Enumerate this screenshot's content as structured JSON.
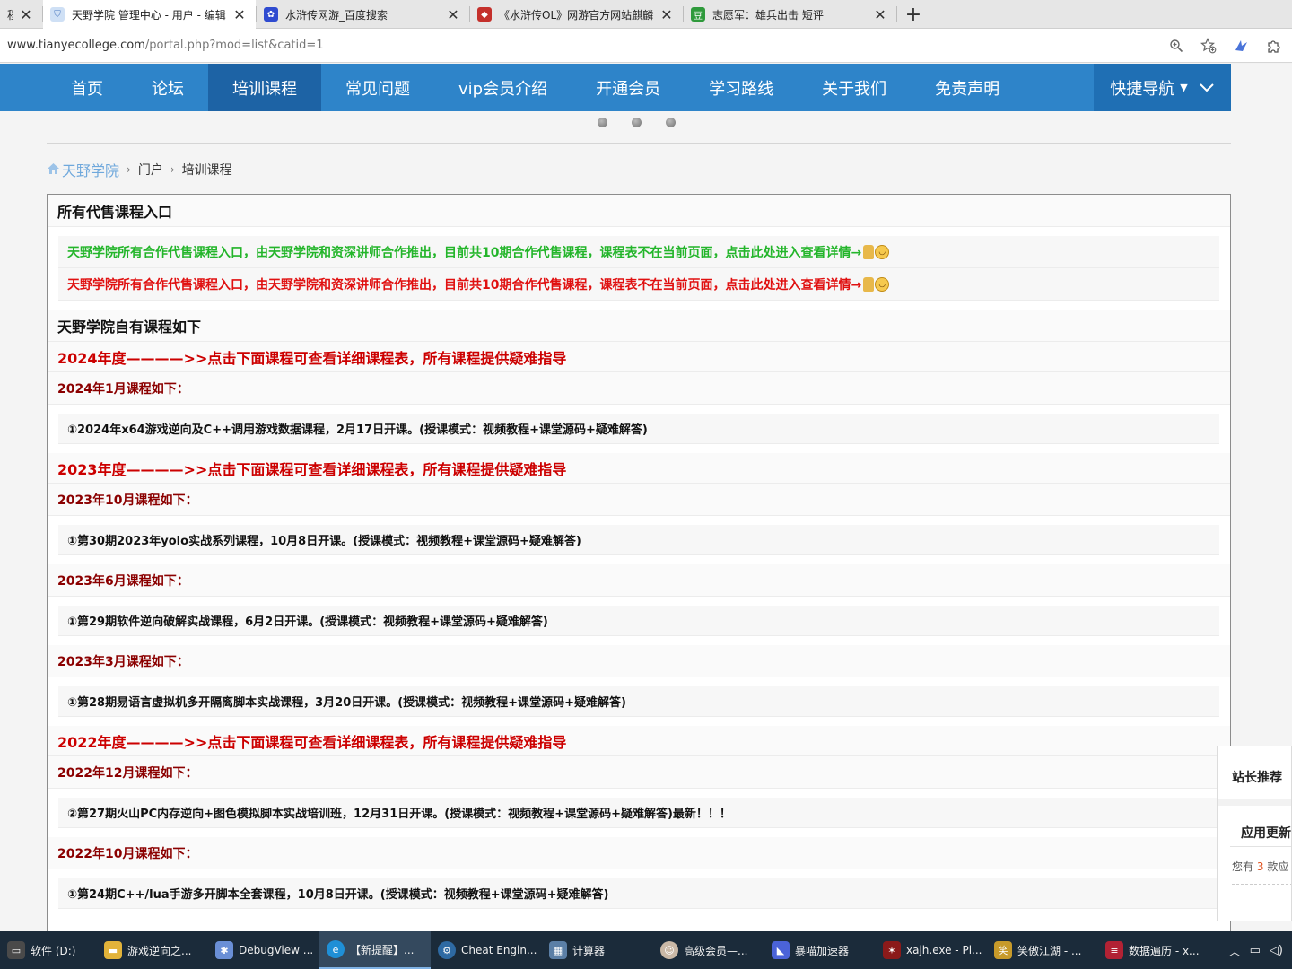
{
  "browser": {
    "tabs": [
      {
        "title": "程",
        "icon": "page-icon",
        "active": false
      },
      {
        "title": "天野学院 管理中心 - 用户 - 编辑",
        "icon": "shield-icon",
        "active": true
      },
      {
        "title": "水浒传网游_百度搜索",
        "icon": "baidu-paw-icon",
        "active": false
      },
      {
        "title": "《水浒传OL》网游官方网站麒麟",
        "icon": "game-site-icon",
        "active": false
      },
      {
        "title": "志愿军：雄兵出击 短评",
        "icon": "douban-icon",
        "active": false
      }
    ],
    "new_tab_glyph": "+",
    "close_glyph": "✕",
    "url_host": "www.tianyecollege.com",
    "url_path": "/portal.php?mod=list&catid=1"
  },
  "nav": {
    "items": [
      "首页",
      "论坛",
      "培训课程",
      "常见问题",
      "vip会员介绍",
      "开通会员",
      "学习路线",
      "关于我们",
      "免责声明"
    ],
    "active_index": 2,
    "quick_label": "快捷导航"
  },
  "breadcrumb": {
    "home": "天野学院",
    "items": [
      "门户",
      "培训课程"
    ]
  },
  "content": {
    "box_title": "所有代售课程入口",
    "notice_green": "天野学院所有合作代售课程入口，由天野学院和资深讲师合作推出，目前共10期合作代售课程，课程表不在当前页面，点击此处进入查看详情→",
    "notice_red": "天野学院所有合作代售课程入口，由天野学院和资深讲师合作推出，目前共10期合作代售课程，课程表不在当前页面，点击此处进入查看详情→",
    "own_title": "天野学院自有课程如下",
    "y2024": "2024年度————>>点击下面课程可查看详细课程表，所有课程提供疑难指导",
    "m2024_1": "2024年1月课程如下：",
    "c2024_1": "①2024年x64游戏逆向及C++调用游戏数据课程，2月17日开课。(授课模式：视频教程+课堂源码+疑难解答)",
    "y2023": "2023年度————>>点击下面课程可查看详细课程表，所有课程提供疑难指导",
    "m2023_10": "2023年10月课程如下：",
    "c2023_10": "①第30期2023年yolo实战系列课程，10月8日开课。(授课模式：视频教程+课堂源码+疑难解答)",
    "m2023_6": "2023年6月课程如下：",
    "c2023_6": "①第29期软件逆向破解实战课程，6月2日开课。(授课模式：视频教程+课堂源码+疑难解答)",
    "m2023_3": "2023年3月课程如下：",
    "c2023_3": "①第28期易语言虚拟机多开隔离脚本实战课程，3月20日开课。(授课模式：视频教程+课堂源码+疑难解答)",
    "y2022": "2022年度————>>点击下面课程可查看详细课程表，所有课程提供疑难指导",
    "m2022_12": "2022年12月课程如下：",
    "c2022_12": "②第27期火山PC内存逆向+图色模拟脚本实战培训班，12月31日开课。(授课模式：视频教程+课堂源码+疑难解答)最新！！！",
    "m2022_10": "2022年10月课程如下：",
    "c2022_10": "①第24期C++/lua手游多开脚本全套课程，10月8日开课。(授课模式：视频教程+课堂源码+疑难解答)"
  },
  "sidepanel": {
    "title": "站长推荐",
    "subtitle": "应用更新",
    "text_prefix": "您有",
    "count": "3",
    "text_suffix": "款应"
  },
  "taskbar": {
    "items": [
      {
        "label": "软件 (D:)",
        "icon": "drive-icon",
        "color": "#4a4a4a"
      },
      {
        "label": "游戏逆向之...",
        "icon": "folder-icon",
        "color": "#e2b33a"
      },
      {
        "label": "DebugView ...",
        "icon": "debugview-icon",
        "color": "#6a8fd6"
      },
      {
        "label": "【新提醒】...",
        "icon": "edge-browser-icon",
        "color": "#1f8fd6"
      },
      {
        "label": "Cheat Engin...",
        "icon": "cheat-engine-icon",
        "color": "#2e6aa3"
      },
      {
        "label": "计算器",
        "icon": "calculator-icon",
        "color": "#5b7fa6"
      },
      {
        "label": "高级会员—...",
        "icon": "avatar-icon",
        "color": "#c9b8a6"
      },
      {
        "label": "暴喵加速器",
        "icon": "cat-accelerator-icon",
        "color": "#4b63d8"
      },
      {
        "label": "xajh.exe - Pl...",
        "icon": "process-icon",
        "color": "#8b1a1a"
      },
      {
        "label": "笑傲江湖 - ...",
        "icon": "game-icon",
        "color": "#c79a2a"
      },
      {
        "label": "数据遍历 - x...",
        "icon": "flag-icon",
        "color": "#b22234"
      }
    ],
    "active_index": 3
  }
}
